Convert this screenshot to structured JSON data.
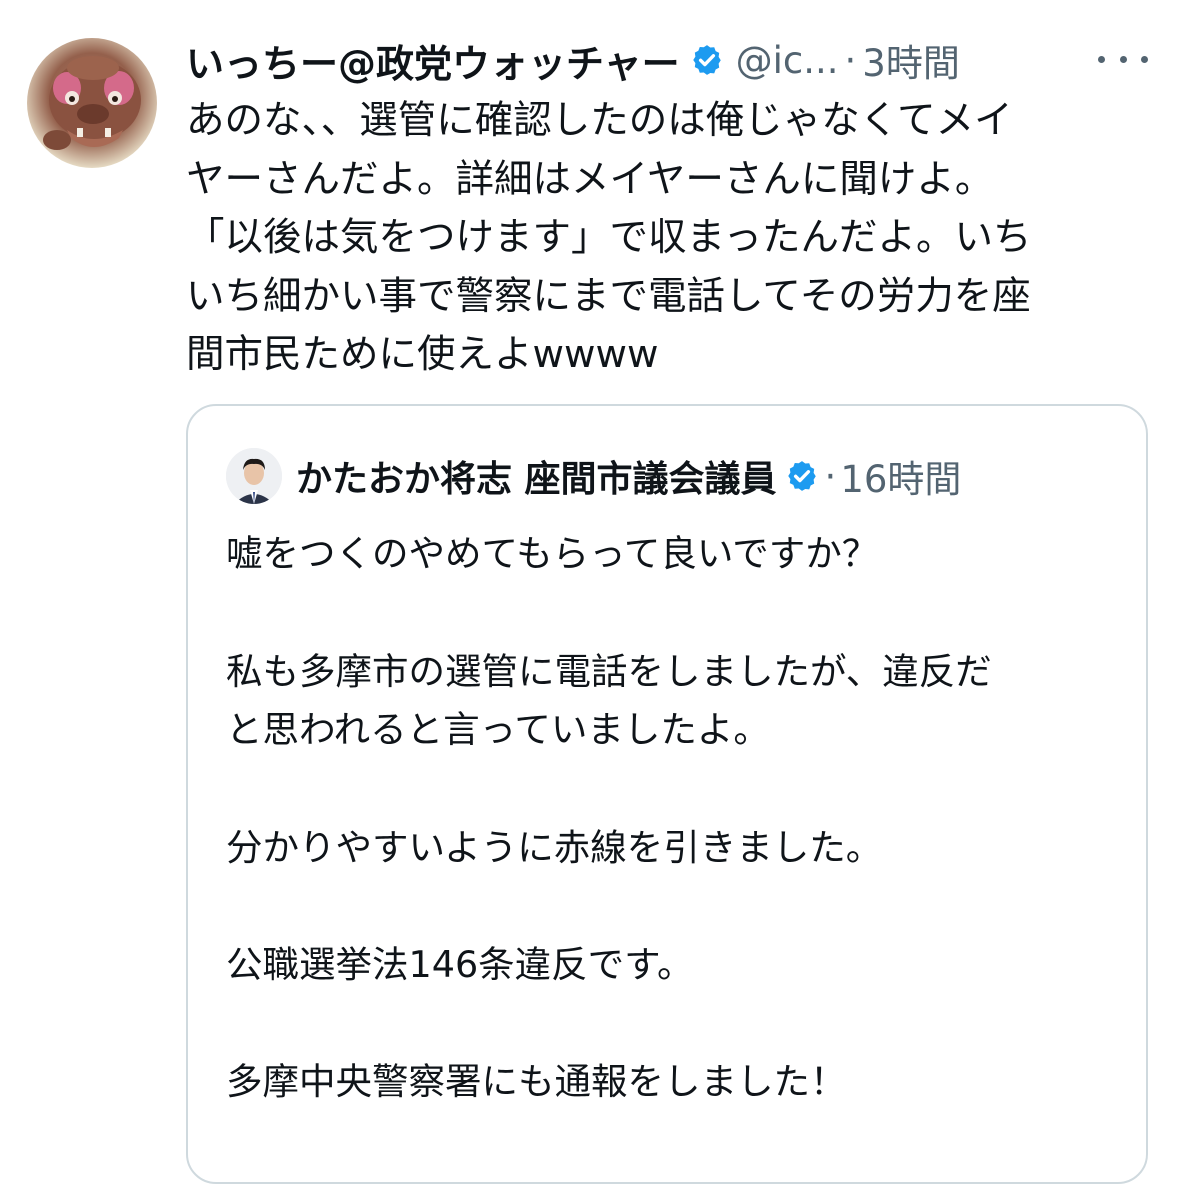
{
  "tweet": {
    "author_name": "いっちー@政党ウォッチャー",
    "handle": "@ic...",
    "dot": "·",
    "time": "3時間",
    "lines": [
      "あのな、、選管に確認したのは俺じゃなくてメイ",
      "ヤーさんだよ。詳細はメイヤーさんに聞けよ。",
      "「以後は気をつけます」で収まったんだよ。いち",
      "いち細かい事で警察にまで電話してその労力を座",
      "間市民ために使えよwwww"
    ]
  },
  "quote": {
    "author_name": "かたおか将志 座間市議会議員",
    "dot": "·",
    "time": "16時間",
    "lines": [
      "嘘をつくのやめてもらって良いですか？",
      "私も多摩市の選管に電話をしましたが、違反だ",
      "と思われると言っていましたよ。",
      "分かりやすいように赤線を引きました。",
      "公職選挙法146条違反です。",
      "多摩中央警察署にも通報をしました！"
    ]
  },
  "icons": {
    "verified": "verified-badge-icon",
    "more": "more-options-icon"
  },
  "colors": {
    "verified_blue": "#1d9bf0",
    "text_primary": "#0f1419",
    "text_secondary": "#536471",
    "border": "#cfd9de"
  }
}
